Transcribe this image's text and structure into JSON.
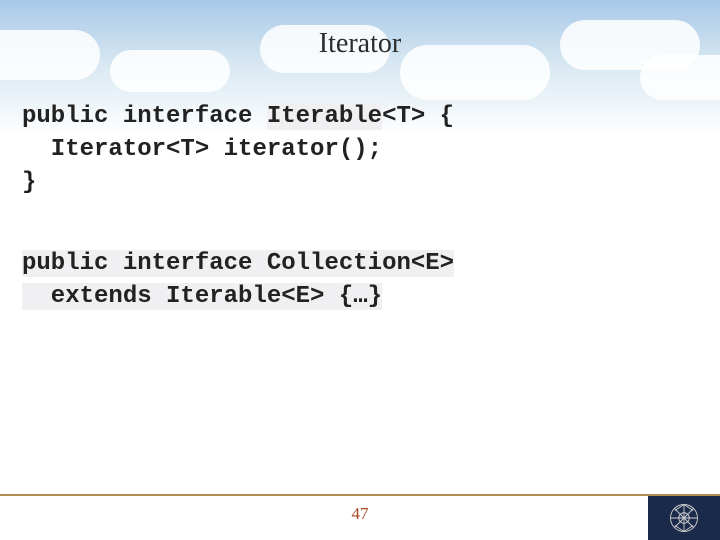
{
  "slide": {
    "title": "Iterator",
    "page_number": "47"
  },
  "code": {
    "block1": {
      "l1_a": "public interface ",
      "l1_b": "Iterable",
      "l1_c": "<T> {",
      "l2": "  Iterator<T> iterator();",
      "l3": "}"
    },
    "block2": {
      "l1_a": "public interface ",
      "l1_b": "Collection",
      "l1_c": "<E>",
      "l2_a": "  extends ",
      "l2_b": "Iterable",
      "l2_c": "<E> {…}"
    }
  }
}
